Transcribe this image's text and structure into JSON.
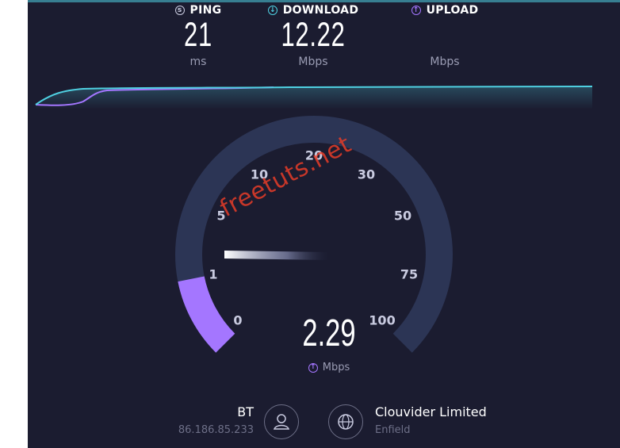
{
  "metrics": {
    "ping": {
      "label": "PING",
      "value": "21",
      "unit": "ms",
      "icon": "ping-icon"
    },
    "download": {
      "label": "DOWNLOAD",
      "value": "12.22",
      "unit": "Mbps",
      "icon": "download-arrow-icon"
    },
    "upload": {
      "label": "UPLOAD",
      "value": "",
      "unit": "Mbps",
      "icon": "upload-arrow-icon"
    }
  },
  "gauge": {
    "ticks": [
      "0",
      "1",
      "5",
      "10",
      "20",
      "30",
      "50",
      "75",
      "100"
    ],
    "current_speed": "2.29",
    "current_unit": "Mbps",
    "current_fraction": 0.125
  },
  "isp": {
    "name": "BT",
    "ip": "86.186.85.233"
  },
  "server": {
    "name": "Clouvider Limited",
    "location": "Enfield"
  },
  "watermark": "freetuts.net",
  "colors": {
    "background": "#1b1c30",
    "download": "#4fd0e1",
    "upload": "#a476ff",
    "track": "#2c3555"
  }
}
